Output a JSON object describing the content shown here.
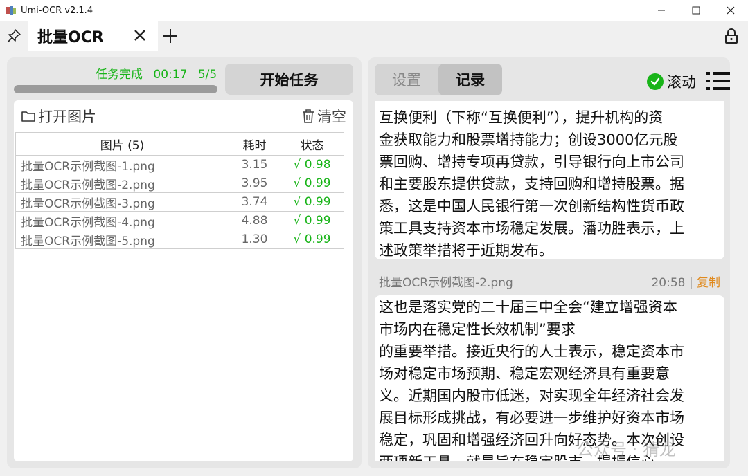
{
  "window": {
    "title": "Umi-OCR v2.1.4",
    "minimize_icon": "minimize-icon",
    "maximize_icon": "maximize-icon",
    "close_icon": "close-icon"
  },
  "tabs": {
    "active_label": "批量OCR"
  },
  "left": {
    "status": {
      "state": "任务完成",
      "elapsed": "00:17",
      "count": "5/5"
    },
    "progress": 1.0,
    "start_button": "开始任务",
    "open_button": "打开图片",
    "clear_button": "清空",
    "table": {
      "headers": [
        "图片 (5)",
        "耗时",
        "状态"
      ],
      "rows": [
        {
          "name": "批量OCR示例截图-1.png",
          "time": "3.15",
          "status": "√ 0.98"
        },
        {
          "name": "批量OCR示例截图-2.png",
          "time": "3.95",
          "status": "√ 0.99"
        },
        {
          "name": "批量OCR示例截图-3.png",
          "time": "3.74",
          "status": "√ 0.99"
        },
        {
          "name": "批量OCR示例截图-4.png",
          "time": "4.88",
          "status": "√ 0.99"
        },
        {
          "name": "批量OCR示例截图-5.png",
          "time": "1.30",
          "status": "√ 0.99"
        }
      ]
    }
  },
  "right": {
    "tabs": [
      "设置",
      "记录"
    ],
    "active_tab": "记录",
    "scroll_label": "滚动",
    "records": [
      {
        "lines": [
          "互换便利（下称“互换便利”），提升机构的资",
          "金获取能力和股票增持能力；创设3000亿元股",
          "票回购、增持专项再贷款，引导银行向上市公司",
          "和主要股东提供贷款，支持回购和增持股票。据",
          "悉，这是中国人民银行第一次创新结构性货币政",
          "策工具支持资本市场稳定发展。潘功胜表示，上",
          "述政策举措将于近期发布。"
        ]
      },
      {
        "file": "批量OCR示例截图-2.png",
        "time": "20:58",
        "separator": "|",
        "copy_label": "复制",
        "lines": [
          "这也是落实党的二十届三中全会“建立增强资本",
          "市场内在稳定性长效机制”要求",
          "的重要举措。接近央行的人士表示，稳定资本市",
          "场对稳定市场预期、稳定宏观经济具有重要意",
          "义。近期国内股市低迷，对实现全年经济社会发",
          "展目标形成挑战，有必要进一步维护好资本市场",
          "稳定，巩固和增强经济回升向好态势。本次创设",
          "两项新工具，就是旨在稳定股市，提振信心。"
        ]
      }
    ]
  },
  "watermark": "公众号 · 猜龙",
  "colors": {
    "success": "#18b418",
    "copy": "#e08a1e"
  }
}
